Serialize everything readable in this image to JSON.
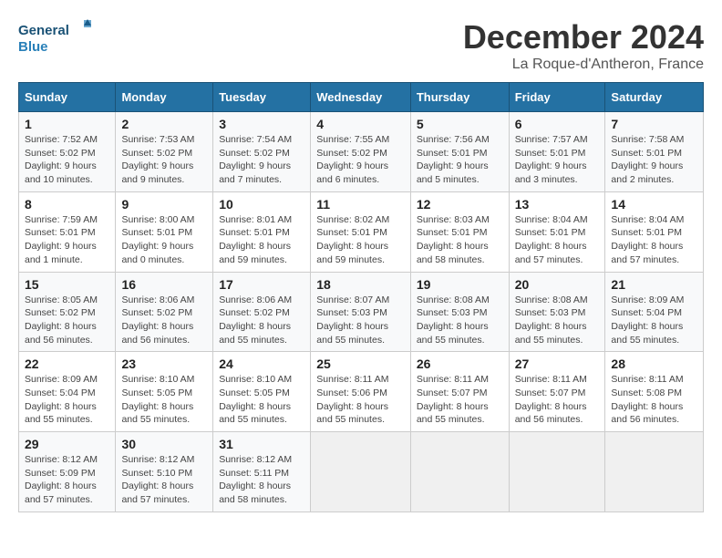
{
  "header": {
    "logo_general": "General",
    "logo_blue": "Blue",
    "month_title": "December 2024",
    "location": "La Roque-d'Antheron, France"
  },
  "weekdays": [
    "Sunday",
    "Monday",
    "Tuesday",
    "Wednesday",
    "Thursday",
    "Friday",
    "Saturday"
  ],
  "weeks": [
    [
      {
        "day": "1",
        "sunrise": "7:52 AM",
        "sunset": "5:02 PM",
        "daylight": "9 hours and 10 minutes."
      },
      {
        "day": "2",
        "sunrise": "7:53 AM",
        "sunset": "5:02 PM",
        "daylight": "9 hours and 9 minutes."
      },
      {
        "day": "3",
        "sunrise": "7:54 AM",
        "sunset": "5:02 PM",
        "daylight": "9 hours and 7 minutes."
      },
      {
        "day": "4",
        "sunrise": "7:55 AM",
        "sunset": "5:02 PM",
        "daylight": "9 hours and 6 minutes."
      },
      {
        "day": "5",
        "sunrise": "7:56 AM",
        "sunset": "5:01 PM",
        "daylight": "9 hours and 5 minutes."
      },
      {
        "day": "6",
        "sunrise": "7:57 AM",
        "sunset": "5:01 PM",
        "daylight": "9 hours and 3 minutes."
      },
      {
        "day": "7",
        "sunrise": "7:58 AM",
        "sunset": "5:01 PM",
        "daylight": "9 hours and 2 minutes."
      }
    ],
    [
      {
        "day": "8",
        "sunrise": "7:59 AM",
        "sunset": "5:01 PM",
        "daylight": "9 hours and 1 minute."
      },
      {
        "day": "9",
        "sunrise": "8:00 AM",
        "sunset": "5:01 PM",
        "daylight": "9 hours and 0 minutes."
      },
      {
        "day": "10",
        "sunrise": "8:01 AM",
        "sunset": "5:01 PM",
        "daylight": "8 hours and 59 minutes."
      },
      {
        "day": "11",
        "sunrise": "8:02 AM",
        "sunset": "5:01 PM",
        "daylight": "8 hours and 59 minutes."
      },
      {
        "day": "12",
        "sunrise": "8:03 AM",
        "sunset": "5:01 PM",
        "daylight": "8 hours and 58 minutes."
      },
      {
        "day": "13",
        "sunrise": "8:04 AM",
        "sunset": "5:01 PM",
        "daylight": "8 hours and 57 minutes."
      },
      {
        "day": "14",
        "sunrise": "8:04 AM",
        "sunset": "5:01 PM",
        "daylight": "8 hours and 57 minutes."
      }
    ],
    [
      {
        "day": "15",
        "sunrise": "8:05 AM",
        "sunset": "5:02 PM",
        "daylight": "8 hours and 56 minutes."
      },
      {
        "day": "16",
        "sunrise": "8:06 AM",
        "sunset": "5:02 PM",
        "daylight": "8 hours and 56 minutes."
      },
      {
        "day": "17",
        "sunrise": "8:06 AM",
        "sunset": "5:02 PM",
        "daylight": "8 hours and 55 minutes."
      },
      {
        "day": "18",
        "sunrise": "8:07 AM",
        "sunset": "5:03 PM",
        "daylight": "8 hours and 55 minutes."
      },
      {
        "day": "19",
        "sunrise": "8:08 AM",
        "sunset": "5:03 PM",
        "daylight": "8 hours and 55 minutes."
      },
      {
        "day": "20",
        "sunrise": "8:08 AM",
        "sunset": "5:03 PM",
        "daylight": "8 hours and 55 minutes."
      },
      {
        "day": "21",
        "sunrise": "8:09 AM",
        "sunset": "5:04 PM",
        "daylight": "8 hours and 55 minutes."
      }
    ],
    [
      {
        "day": "22",
        "sunrise": "8:09 AM",
        "sunset": "5:04 PM",
        "daylight": "8 hours and 55 minutes."
      },
      {
        "day": "23",
        "sunrise": "8:10 AM",
        "sunset": "5:05 PM",
        "daylight": "8 hours and 55 minutes."
      },
      {
        "day": "24",
        "sunrise": "8:10 AM",
        "sunset": "5:05 PM",
        "daylight": "8 hours and 55 minutes."
      },
      {
        "day": "25",
        "sunrise": "8:11 AM",
        "sunset": "5:06 PM",
        "daylight": "8 hours and 55 minutes."
      },
      {
        "day": "26",
        "sunrise": "8:11 AM",
        "sunset": "5:07 PM",
        "daylight": "8 hours and 55 minutes."
      },
      {
        "day": "27",
        "sunrise": "8:11 AM",
        "sunset": "5:07 PM",
        "daylight": "8 hours and 56 minutes."
      },
      {
        "day": "28",
        "sunrise": "8:11 AM",
        "sunset": "5:08 PM",
        "daylight": "8 hours and 56 minutes."
      }
    ],
    [
      {
        "day": "29",
        "sunrise": "8:12 AM",
        "sunset": "5:09 PM",
        "daylight": "8 hours and 57 minutes."
      },
      {
        "day": "30",
        "sunrise": "8:12 AM",
        "sunset": "5:10 PM",
        "daylight": "8 hours and 57 minutes."
      },
      {
        "day": "31",
        "sunrise": "8:12 AM",
        "sunset": "5:11 PM",
        "daylight": "8 hours and 58 minutes."
      },
      null,
      null,
      null,
      null
    ]
  ]
}
